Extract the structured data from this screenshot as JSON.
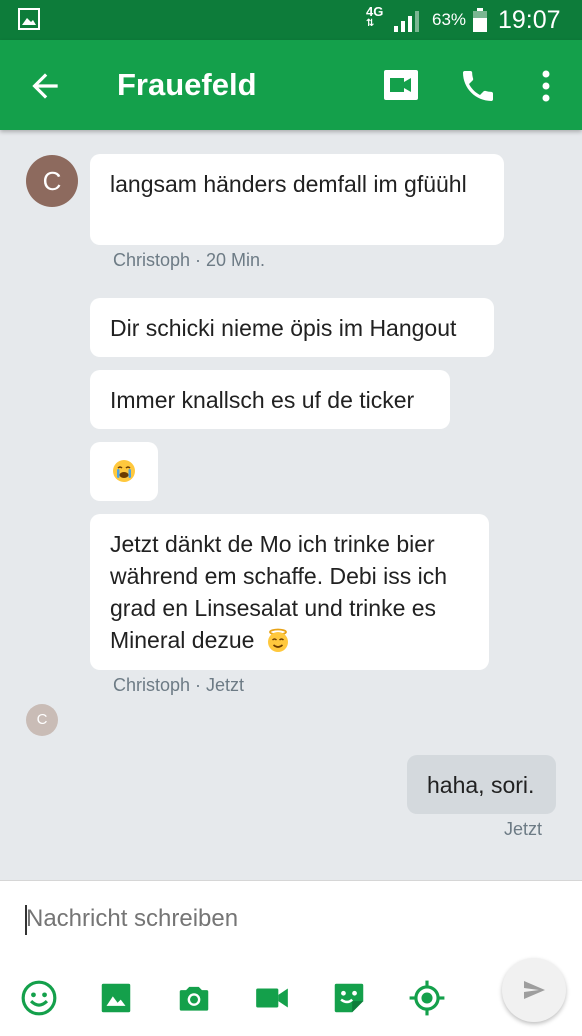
{
  "status_bar": {
    "network": "4G",
    "battery_percent": "63%",
    "time": "19:07"
  },
  "app_bar": {
    "title": "Frauefeld",
    "back_icon": "arrow-back-icon",
    "video_icon": "videocam-icon",
    "call_icon": "phone-icon",
    "more_icon": "more-vert-icon"
  },
  "conversation": {
    "avatar_letter": "C",
    "messages": [
      {
        "text": "langsam händers demfall im gfüühl"
      },
      {
        "meta": "Christoph · 20 Min."
      },
      {
        "text": "Dir schicki nieme öpis im Hangout"
      },
      {
        "text": "Immer knallsch es uf de ticker"
      },
      {
        "emoji": "sad-crying-face-emoji"
      },
      {
        "text_line1": "Jetzt dänkt de Mo ich trinke bier",
        "text_line2": "während em schaffe. Debi iss ich",
        "text_line3": "grad en Linsesalat und trinke es",
        "text_line4": "Mineral dezue",
        "emoji": "smiling-face-with-halo-emoji"
      },
      {
        "meta": "Christoph · Jetzt"
      }
    ],
    "read_receipt_letter": "C",
    "outgoing": {
      "text": "haha, sori.",
      "meta": "Jetzt"
    }
  },
  "compose": {
    "placeholder": "Nachricht schreiben",
    "tools": [
      "emoji-icon",
      "gallery-icon",
      "camera-icon",
      "video-icon",
      "sticker-icon",
      "location-icon"
    ],
    "send_icon": "send-icon"
  },
  "colors": {
    "status_bar": "#0d7c3a",
    "app_bar": "#14a04b",
    "background": "#e6e9ec",
    "outgoing_bubble": "#d4d9dd",
    "avatar": "#8d6a5e"
  }
}
